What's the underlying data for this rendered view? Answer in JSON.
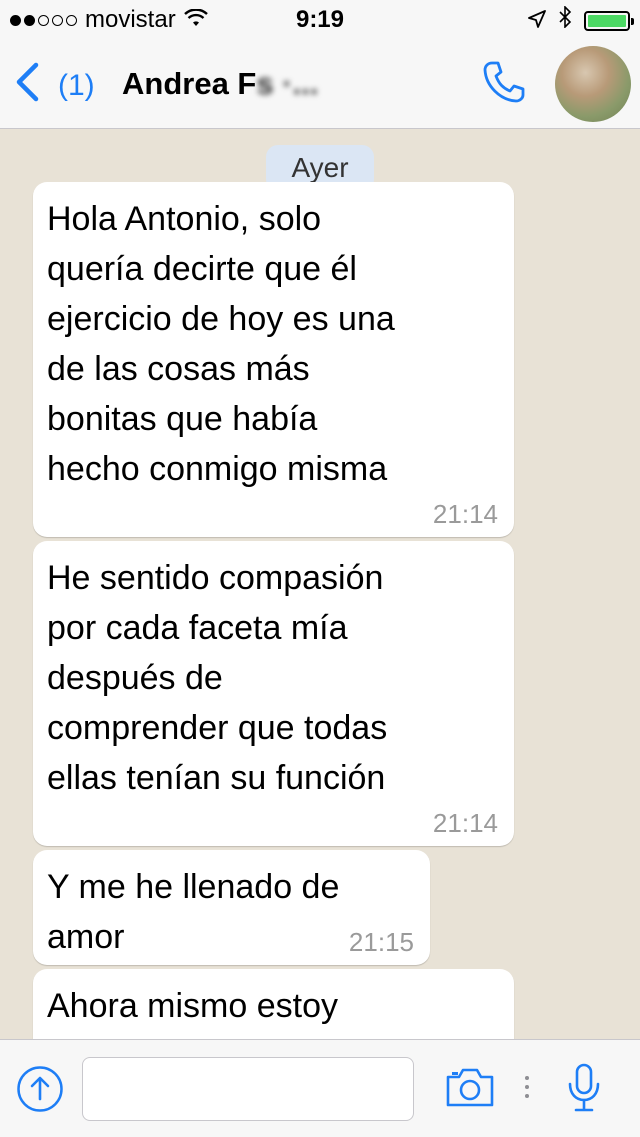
{
  "status_bar": {
    "carrier": "movistar",
    "time": "9:19",
    "signal_bars_filled": 2,
    "signal_bars_total": 5,
    "battery_level": 1.0
  },
  "header": {
    "back_count": "(1)",
    "contact_name": "Andrea F",
    "contact_name_tail": "s    ·..."
  },
  "chat": {
    "date_label": "Ayer",
    "messages": [
      {
        "text": "Hola Antonio, solo\nquería decirte que él\nejercicio de hoy es una\nde las cosas más\nbonitas que había\nhecho conmigo misma",
        "time": "21:14"
      },
      {
        "text": "He sentido compasión\npor cada faceta mía\ndespués de\ncomprender que todas\nellas tenían su función",
        "time": "21:14"
      },
      {
        "text": "Y me he llenado de\namor",
        "time": "21:15"
      },
      {
        "text": "Ahora mismo estoy\nrecibiendo de todo lo",
        "time": ""
      }
    ]
  },
  "input_bar": {
    "message_value": "",
    "message_placeholder": ""
  },
  "colors": {
    "accent": "#1e7ef6",
    "battery": "#4cd964",
    "date_pill": "#dbe6f4",
    "chat_bg": "#e8e2d6"
  },
  "icons": [
    "wifi-icon",
    "location-arrow-icon",
    "bluetooth-icon",
    "battery-icon",
    "back-chevron-icon",
    "phone-icon",
    "upload-icon",
    "camera-icon",
    "more-icon",
    "microphone-icon"
  ]
}
